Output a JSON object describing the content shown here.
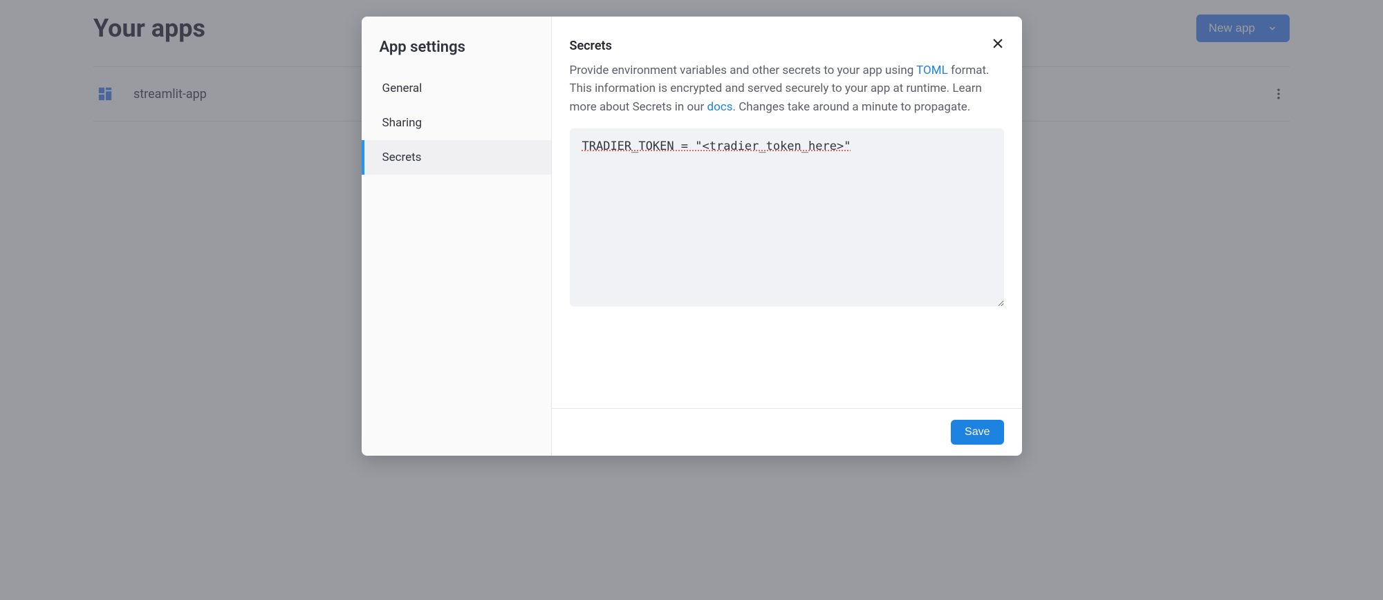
{
  "background": {
    "page_title": "Your apps",
    "new_app_label": "New app",
    "app_row": {
      "name": "streamlit-app"
    }
  },
  "modal": {
    "sidebar": {
      "title": "App settings",
      "items": [
        {
          "label": "General",
          "active": false
        },
        {
          "label": "Sharing",
          "active": false
        },
        {
          "label": "Secrets",
          "active": true
        }
      ]
    },
    "section_title": "Secrets",
    "description": {
      "part1": "Provide environment variables and other secrets to your app using ",
      "link1_text": "TOML",
      "part2": " format. This information is encrypted and served securely to your app at runtime. Learn more about Secrets in our ",
      "link2_text": "docs",
      "part3": ". Changes take around a minute to propagate."
    },
    "secrets_value": "TRADIER_TOKEN = \"<tradier_token_here>\"",
    "save_label": "Save"
  }
}
